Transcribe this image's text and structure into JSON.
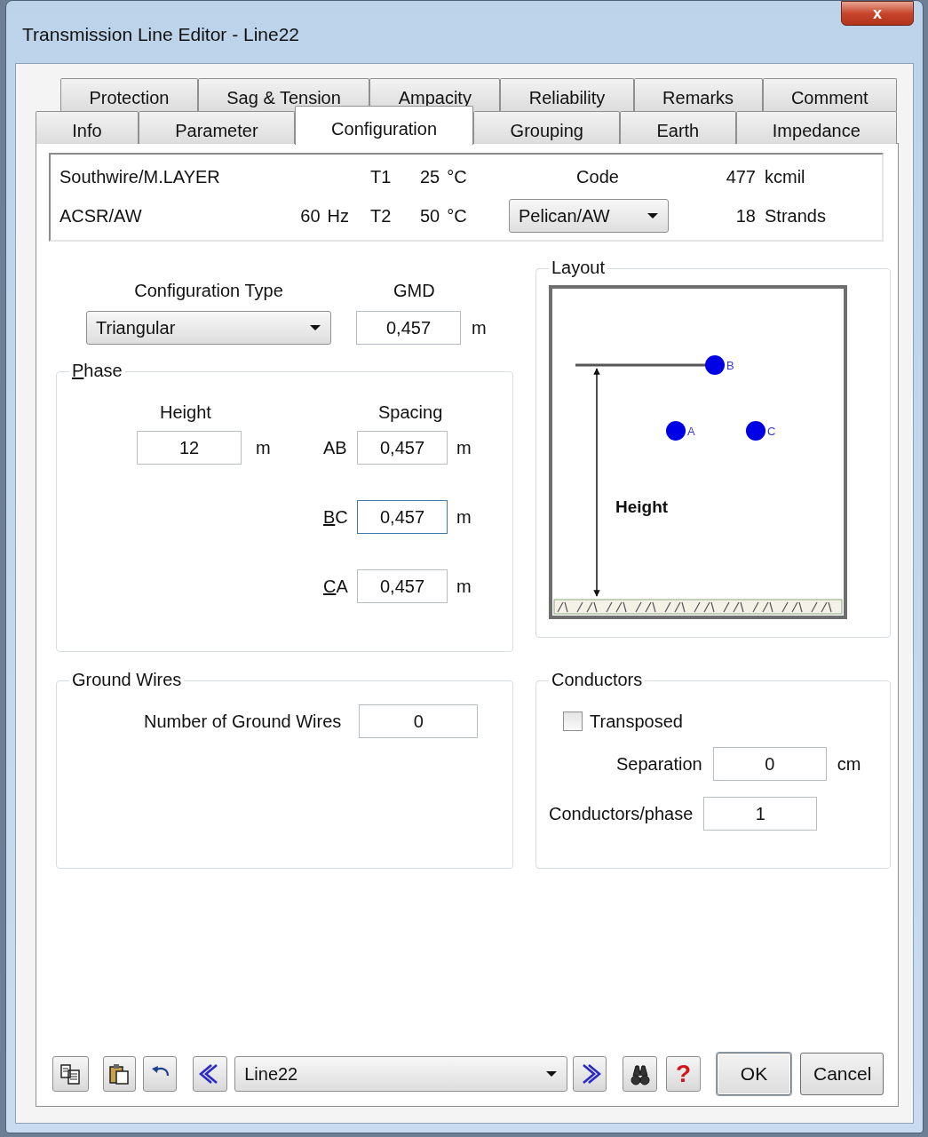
{
  "window": {
    "title": "Transmission Line Editor - Line22",
    "close_glyph": "x"
  },
  "tabs_back": [
    {
      "label": "Protection",
      "selected": false
    },
    {
      "label": "Sag & Tension",
      "selected": false
    },
    {
      "label": "Ampacity",
      "selected": false
    },
    {
      "label": "Reliability",
      "selected": false
    },
    {
      "label": "Remarks",
      "selected": false
    },
    {
      "label": "Comment",
      "selected": false
    }
  ],
  "tabs_front": [
    {
      "label": "Info",
      "selected": false
    },
    {
      "label": "Parameter",
      "selected": false
    },
    {
      "label": "Configuration",
      "selected": true
    },
    {
      "label": "Grouping",
      "selected": false
    },
    {
      "label": "Earth",
      "selected": false
    },
    {
      "label": "Impedance",
      "selected": false
    }
  ],
  "conductor_info": {
    "manufacturer": "Southwire/M.LAYER",
    "type": "ACSR/AW",
    "frequency": "60",
    "frequency_unit": "Hz",
    "t1_label": "T1",
    "t1_value": "25",
    "t1_unit": "°C",
    "t2_label": "T2",
    "t2_value": "50",
    "t2_unit": "°C",
    "code_label": "Code",
    "code_value": "Pelican/AW",
    "size": "477",
    "size_unit": "kcmil",
    "strands": "18",
    "strands_unit": "Strands"
  },
  "configuration": {
    "type_label": "Configuration Type",
    "type_value": "Triangular",
    "gmd_label": "GMD",
    "gmd_value": "0,457",
    "gmd_unit": "m"
  },
  "phase": {
    "title": "Phase",
    "title_underline_first": true,
    "height_label": "Height",
    "height_value": "12",
    "height_unit": "m",
    "spacing_label": "Spacing",
    "spacings": [
      {
        "label": "AB",
        "value": "0,457",
        "unit": "m",
        "underline_first": false,
        "focused": false
      },
      {
        "label": "BC",
        "value": "0,457",
        "unit": "m",
        "underline_first": true,
        "focused": true
      },
      {
        "label": "CA",
        "value": "0,457",
        "unit": "m",
        "underline_first": true,
        "focused": false
      }
    ]
  },
  "layout": {
    "title": "Layout",
    "phase_labels": [
      "B",
      "A",
      "C"
    ],
    "height_label": "Height"
  },
  "ground_wires": {
    "title": "Ground Wires",
    "count_label": "Number of Ground Wires",
    "count_value": "0"
  },
  "conductors": {
    "title": "Conductors",
    "transposed": {
      "label": "Transposed",
      "checked": false
    },
    "separation_label": "Separation",
    "separation_value": "0",
    "separation_unit": "cm",
    "per_phase_label": "Conductors/phase",
    "per_phase_value": "1"
  },
  "toolbar": {
    "line_value": "Line22",
    "help_glyph": "?",
    "buttons": [
      {
        "label": "OK"
      },
      {
        "label": "Cancel"
      }
    ]
  }
}
